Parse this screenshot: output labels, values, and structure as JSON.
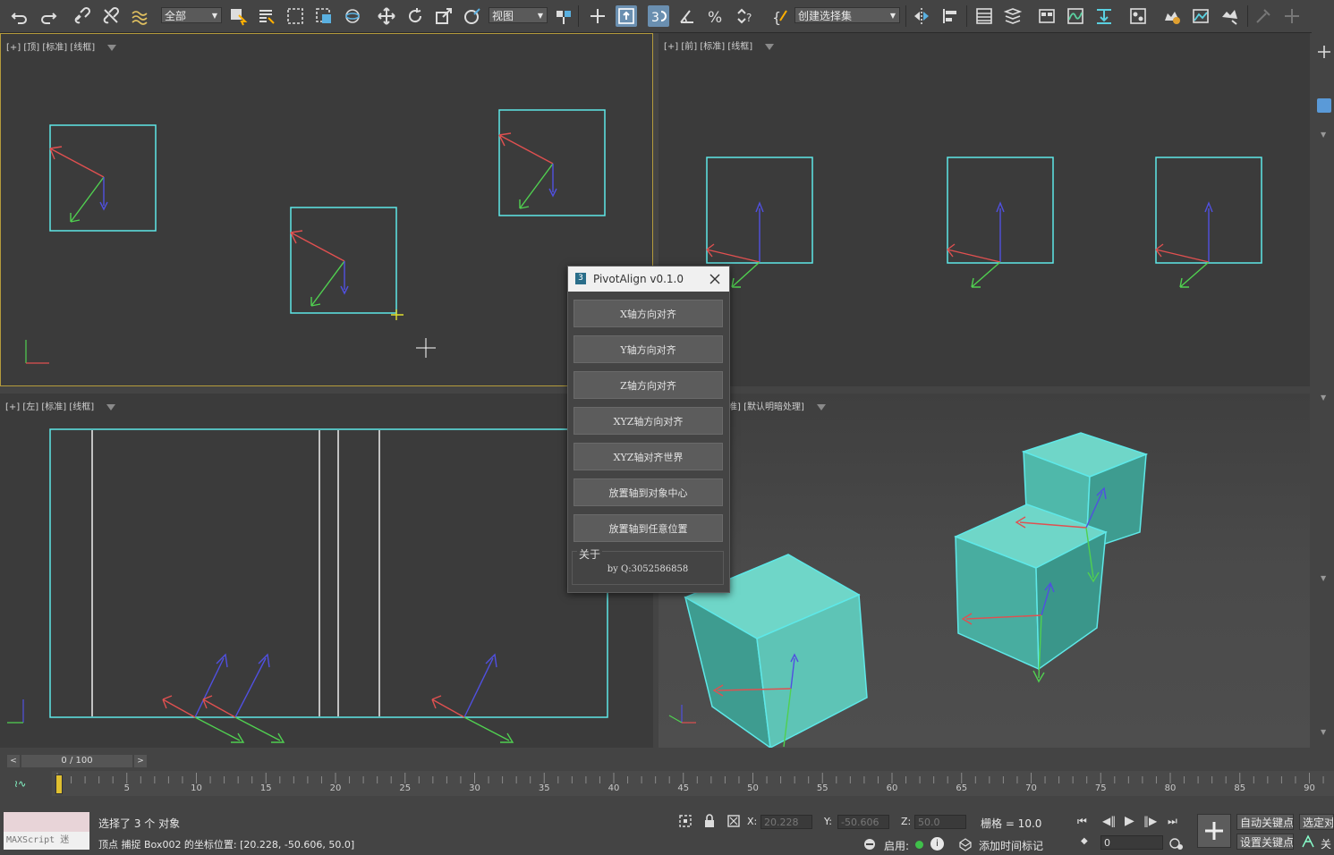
{
  "toolbar": {
    "selection_filter": "全部",
    "ref_coord": "视图",
    "named_selection": "创建选择集"
  },
  "viewports": {
    "top": {
      "label": "[+] [顶] [标准] [线框]"
    },
    "front": {
      "label": "[+] [前] [标准] [线框]"
    },
    "left": {
      "label": "[+] [左] [标准] [线框]"
    },
    "persp": {
      "label": "准] [默认明暗处理]"
    }
  },
  "dialog": {
    "title": "PivotAlign v0.1.0",
    "buttons": [
      "X轴方向对齐",
      "Y轴方向对齐",
      "Z轴方向对齐",
      "XYZ轴方向对齐",
      "XYZ轴对齐世界",
      "放置轴到对象中心",
      "放置轴到任意位置"
    ],
    "about_label": "关于",
    "author": "by Q:3052586858"
  },
  "timeline": {
    "frame_counter": "0 / 100",
    "ticks": [
      "5",
      "10",
      "15",
      "20",
      "25",
      "30",
      "35",
      "40",
      "45",
      "50",
      "55",
      "60",
      "65",
      "70",
      "75",
      "80",
      "85",
      "90"
    ]
  },
  "status": {
    "maxscript_placeholder": "MAXScript 迷",
    "selection_text": "选择了 3 个 对象",
    "prompt_text": "顶点 捕捉 Box002 的坐标位置: [20.228, -50.606, 50.0]",
    "x_label": "X:",
    "x_value": "20.228",
    "y_label": "Y:",
    "y_value": "-50.606",
    "z_label": "Z:",
    "z_value": "50.0",
    "grid_text": "栅格 = 10.0",
    "enable_label": "启用:",
    "add_time_tag": "添加时间标记",
    "auto_key": "自动关键点",
    "set_key": "设置关键点",
    "selected_label": "选定对",
    "key_filters": "关",
    "frame_value": "0"
  },
  "colors": {
    "selection_cyan": "#5ee8e8",
    "cube_teal": "#4fc2b4",
    "axis_red": "#e05050",
    "axis_green": "#50d050",
    "axis_blue": "#5050e0"
  }
}
